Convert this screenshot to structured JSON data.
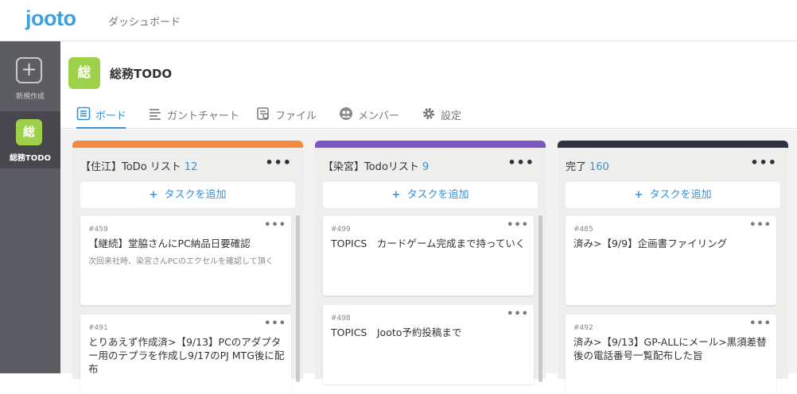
{
  "header": {
    "logo": "jooto",
    "nav_dashboard": "ダッシュボード"
  },
  "sidebar": {
    "new_label": "新規作成",
    "project_badge": "総",
    "project_label": "総務TODO"
  },
  "project": {
    "badge": "総",
    "title": "総務TODO"
  },
  "tabs": [
    {
      "label": "ボード"
    },
    {
      "label": "ガントチャート"
    },
    {
      "label": "ファイル"
    },
    {
      "label": "メンバー"
    },
    {
      "label": "設定"
    }
  ],
  "add_task_label": "タスクを追加",
  "columns": [
    {
      "name": "【住江】ToDo リスト",
      "count": "12",
      "color": "#f58a3c",
      "cards": [
        {
          "num": "#459",
          "title": "【継続】堂脇さんにPC納品日要確認",
          "desc": "次回来社時、染宮さんPCのエクセルを確認して頂く"
        },
        {
          "num": "#491",
          "title": "とりあえず作成済>【9/13】PCのアダプター用のテプラを作成し9/17のPJ MTG後に配布",
          "desc": ""
        }
      ]
    },
    {
      "name": "【染宮】Todoリスト",
      "count": "9",
      "color": "#7c55c0",
      "cards": [
        {
          "num": "#499",
          "title": "TOPICS　カードゲーム完成まで持っていく",
          "desc": ""
        },
        {
          "num": "#498",
          "title": "TOPICS　Jooto予約投稿まで",
          "desc": ""
        }
      ]
    },
    {
      "name": "完了",
      "count": "160",
      "color": "#2e3140",
      "cards": [
        {
          "num": "#485",
          "title": "済み>【9/9】企画書ファイリング",
          "desc": ""
        },
        {
          "num": "#492",
          "title": "済み>【9/13】GP-ALLにメール>黒須差替後の電話番号一覧配布した旨",
          "desc": ""
        }
      ]
    }
  ],
  "colors": {
    "accent": "#3b8fd6",
    "project": "#9ed14a",
    "sidebar": "#5c5c63"
  }
}
